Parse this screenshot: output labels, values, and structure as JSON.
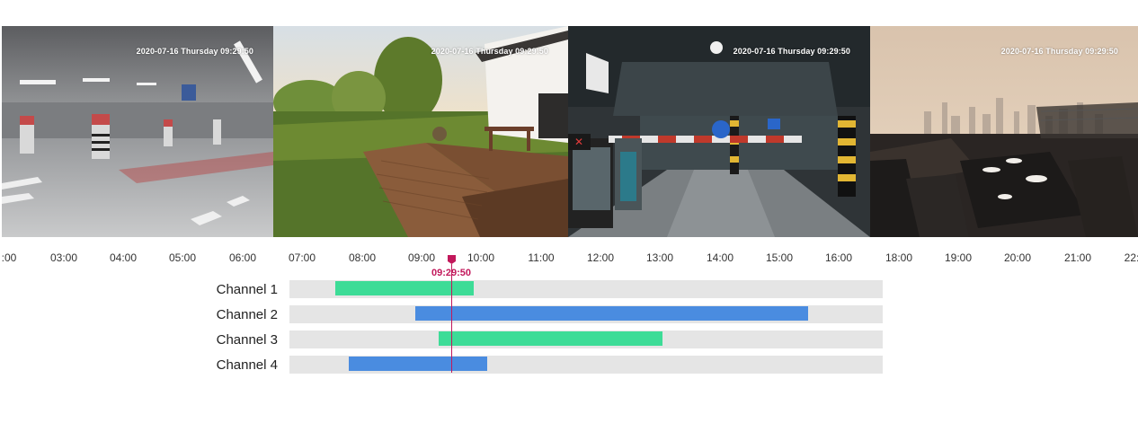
{
  "cameras": [
    {
      "id": "ch1",
      "timestamp": "2020-07-16  Thursday 09:29:50",
      "scene": "parking-garage"
    },
    {
      "id": "ch2",
      "timestamp": "2020-07-16  Thursday 09:29:50",
      "scene": "backyard-deck"
    },
    {
      "id": "ch3",
      "timestamp": "2020-07-16  Thursday 09:29:50",
      "scene": "garage-barrier"
    },
    {
      "id": "ch4",
      "timestamp": "2020-07-16  Thursday 09:29:50",
      "scene": "rooftop-terrace"
    }
  ],
  "timeline": {
    "ticks": [
      ":00",
      "03:00",
      "04:00",
      "05:00",
      "06:00",
      "07:00",
      "08:00",
      "09:00",
      "10:00",
      "11:00",
      "12:00",
      "13:00",
      "14:00",
      "15:00",
      "16:00",
      "18:00",
      "19:00",
      "20:00",
      "21:00",
      "22:"
    ],
    "cursor_time": "09:29:50",
    "cursor_hours": 9.497,
    "channels": [
      {
        "label": "Channel 1",
        "start_hours": 7.55,
        "end_hours": 9.85,
        "color": "#3ddc97"
      },
      {
        "label": "Channel 2",
        "start_hours": 8.9,
        "end_hours": 15.5,
        "color": "#4a8ce0"
      },
      {
        "label": "Channel 3",
        "start_hours": 9.25,
        "end_hours": 13.05,
        "color": "#3ddc97"
      },
      {
        "label": "Channel 4",
        "start_hours": 7.8,
        "end_hours": 10.1,
        "color": "#4a8ce0"
      }
    ],
    "track_range_hours": [
      7.0,
      17.0
    ]
  },
  "colors": {
    "accent": "#c2185b",
    "green": "#3ddc97",
    "blue": "#4a8ce0",
    "track": "#e5e5e5"
  }
}
